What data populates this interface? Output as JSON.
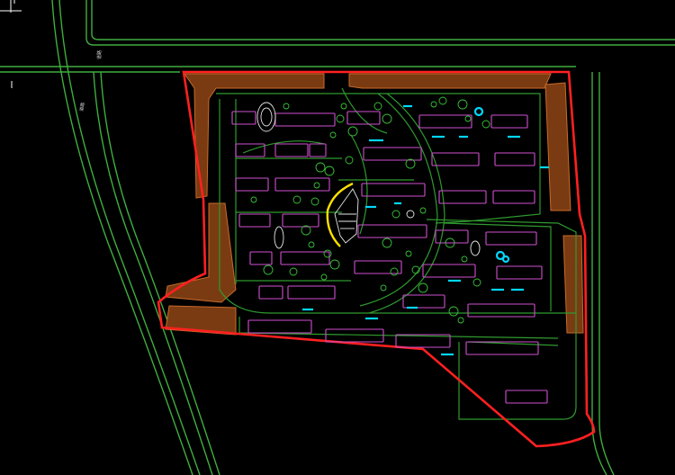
{
  "drawing": {
    "road_label_north": "道路",
    "road_label_west": "道路"
  },
  "colors": {
    "background": "#000000",
    "road": "#3fae3f",
    "building": "#d14fd1",
    "boundary": "#ff2020",
    "buffer": "#7a3b12",
    "water": "#00d8ff",
    "feature_arc": "#ffe000",
    "crosshair": "#ffffff"
  },
  "layers": [
    "site-boundary",
    "roads",
    "buildings",
    "green-buffer",
    "landscape",
    "water-features"
  ]
}
